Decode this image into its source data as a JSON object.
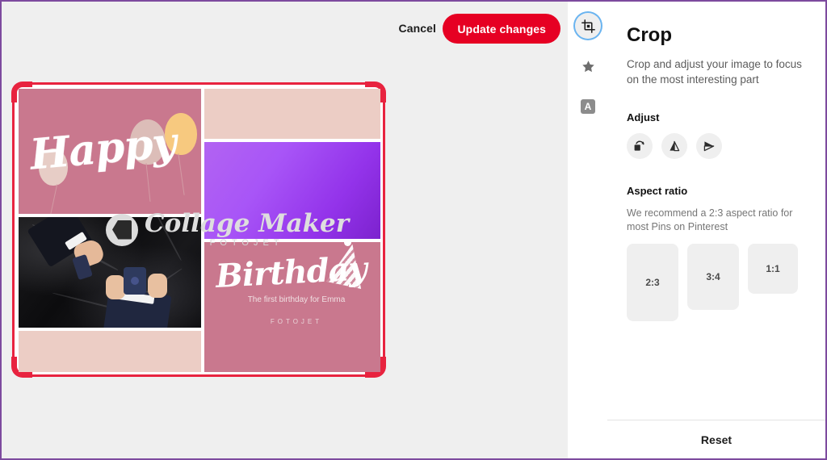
{
  "window": {
    "border_color": "#7d4a9e",
    "canvas_background": "#efefef"
  },
  "toolbar": {
    "cancel_label": "Cancel",
    "update_label": "Update changes",
    "update_color": "#e60023"
  },
  "rail": {
    "items": [
      {
        "name": "crop",
        "icon": "crop-icon",
        "selected": true
      },
      {
        "name": "star",
        "icon": "star-icon",
        "selected": false
      },
      {
        "name": "text",
        "icon": "text-a-icon",
        "label": "A",
        "selected": false
      }
    ],
    "selected_ring_color": "#6ab4f0"
  },
  "panel": {
    "title": "Crop",
    "description": "Crop and adjust your image to focus on the most interesting part",
    "adjust_label": "Adjust",
    "adjust_buttons": [
      {
        "name": "rotate",
        "icon": "rotate-icon"
      },
      {
        "name": "flip-vertical",
        "icon": "flip-vertical-icon"
      },
      {
        "name": "flip-horizontal",
        "icon": "flip-horizontal-icon"
      }
    ],
    "aspect_label": "Aspect ratio",
    "aspect_description": "We recommend a 2:3 aspect ratio for most Pins on Pinterest",
    "aspect_options": [
      {
        "label": "2:3"
      },
      {
        "label": "3:4"
      },
      {
        "label": "1:1"
      }
    ],
    "reset_label": "Reset"
  },
  "crop": {
    "frame_color": "#e8233f"
  },
  "collage": {
    "happy_text": "Happy",
    "birthday_text": "Birthday",
    "birthday_subtitle": "The first birthday for Emma",
    "birthday_brand": "FOTOJET",
    "watermark_title": "Collage Maker",
    "watermark_sub": "FOTOJET",
    "colors": {
      "rose": "#c9788e",
      "blush": "#eccdc5",
      "purple_start": "#b263f2",
      "purple_end": "#7c22ce"
    }
  }
}
